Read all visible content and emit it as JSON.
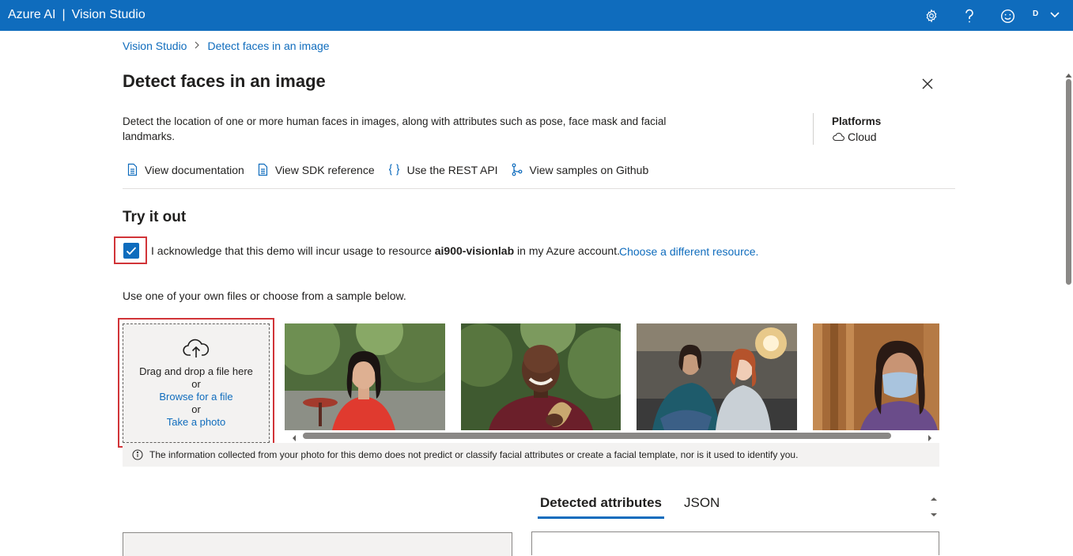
{
  "header": {
    "brand": "Azure AI",
    "separator": "|",
    "product": "Vision Studio",
    "avatar_initial": "D",
    "icons": [
      "gear-icon",
      "help-icon",
      "feedback-smiley-icon",
      "chevron-down-icon"
    ],
    "bar_color": "#0f6cbd"
  },
  "breadcrumb": {
    "root": "Vision Studio",
    "current": "Detect faces in an image"
  },
  "page": {
    "title": "Detect faces in an image",
    "description": "Detect the location of one or more human faces in images, along with attributes such as pose, face mask and facial landmarks.",
    "platforms_heading": "Platforms",
    "platform_value": "Cloud"
  },
  "links": {
    "documentation": "View documentation",
    "sdk_reference": "View SDK reference",
    "rest_api": "Use the REST API",
    "github_samples": "View samples on Github"
  },
  "try_it_out": {
    "title": "Try it out",
    "ack_prefix": "I acknowledge that this demo will incur usage to resource ",
    "ack_resource": "ai900-visionlab",
    "ack_suffix": " in my Azure account.",
    "ack_checked": true,
    "choose_resource_link": "Choose a different resource.",
    "use_files_text": "Use one of your own files or choose from a sample below."
  },
  "upload": {
    "drag_text": "Drag and drop a file here",
    "or_1": "or",
    "browse_link": "Browse for a file",
    "or_2": "or",
    "take_photo_link": "Take a photo"
  },
  "samples": [
    {
      "name": "sample-woman-red-dress"
    },
    {
      "name": "sample-man-holding-mask"
    },
    {
      "name": "sample-two-women-office"
    },
    {
      "name": "sample-woman-face-mask"
    }
  ],
  "info_notice": "The information collected from your photo for this demo does not predict or classify facial attributes or create a facial template, nor is it used to identify you.",
  "results_tabs": {
    "detected_attributes": "Detected attributes",
    "json": "JSON",
    "active": "detected_attributes"
  },
  "colors": {
    "accent": "#0f6cbd",
    "highlight_border": "#d13438"
  }
}
